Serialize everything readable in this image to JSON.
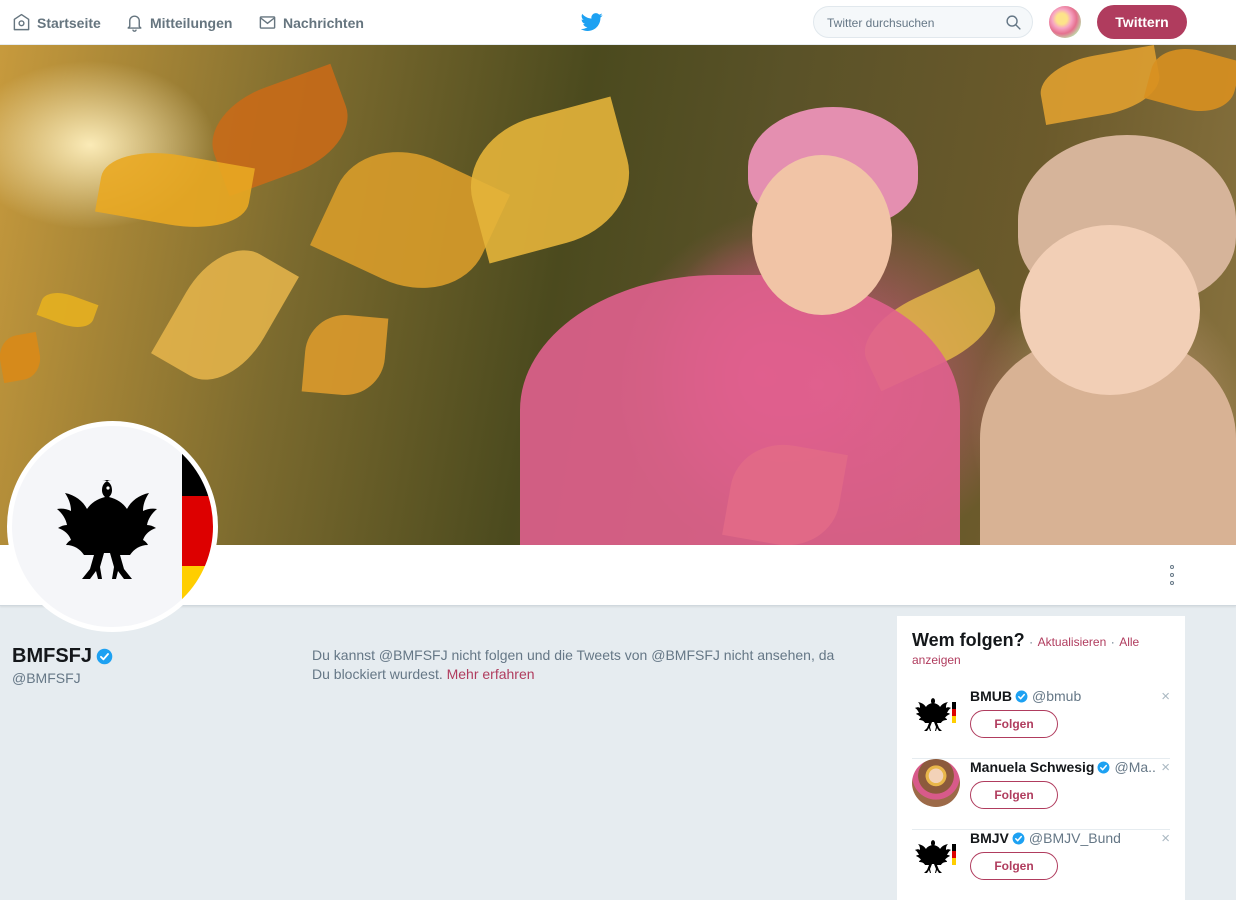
{
  "topnav": {
    "home_label": "Startseite",
    "notifications_label": "Mitteilungen",
    "messages_label": "Nachrichten",
    "search_placeholder": "Twitter durchsuchen",
    "tweet_button": "Twittern"
  },
  "colors": {
    "accent": "#b03c5e",
    "twitter_blue": "#1da1f2",
    "background": "#e6ecf0"
  },
  "profile": {
    "name": "BMFSFJ",
    "handle": "@BMFSFJ",
    "verified": true,
    "blocked_message": "Du kannst @BMFSFJ nicht folgen und die Tweets von @BMFSFJ nicht ansehen, da Du blockiert wurdest.",
    "learn_more": "Mehr erfahren"
  },
  "who_to_follow": {
    "title": "Wem folgen?",
    "separator": "·",
    "refresh": "Aktualisieren",
    "show_all": "Alle anzeigen",
    "items": [
      {
        "name": "BMUB",
        "handle": "@bmub",
        "follow_label": "Folgen",
        "close": "×",
        "avatar": "eagle-logo-icon"
      },
      {
        "name": "Manuela Schwesig",
        "handle": "@Ma..",
        "follow_label": "Folgen",
        "close": "×",
        "avatar": "person-photo"
      },
      {
        "name": "BMJV",
        "handle": "@BMJV_Bund",
        "follow_label": "Folgen",
        "close": "×",
        "avatar": "eagle-logo-icon"
      }
    ]
  }
}
